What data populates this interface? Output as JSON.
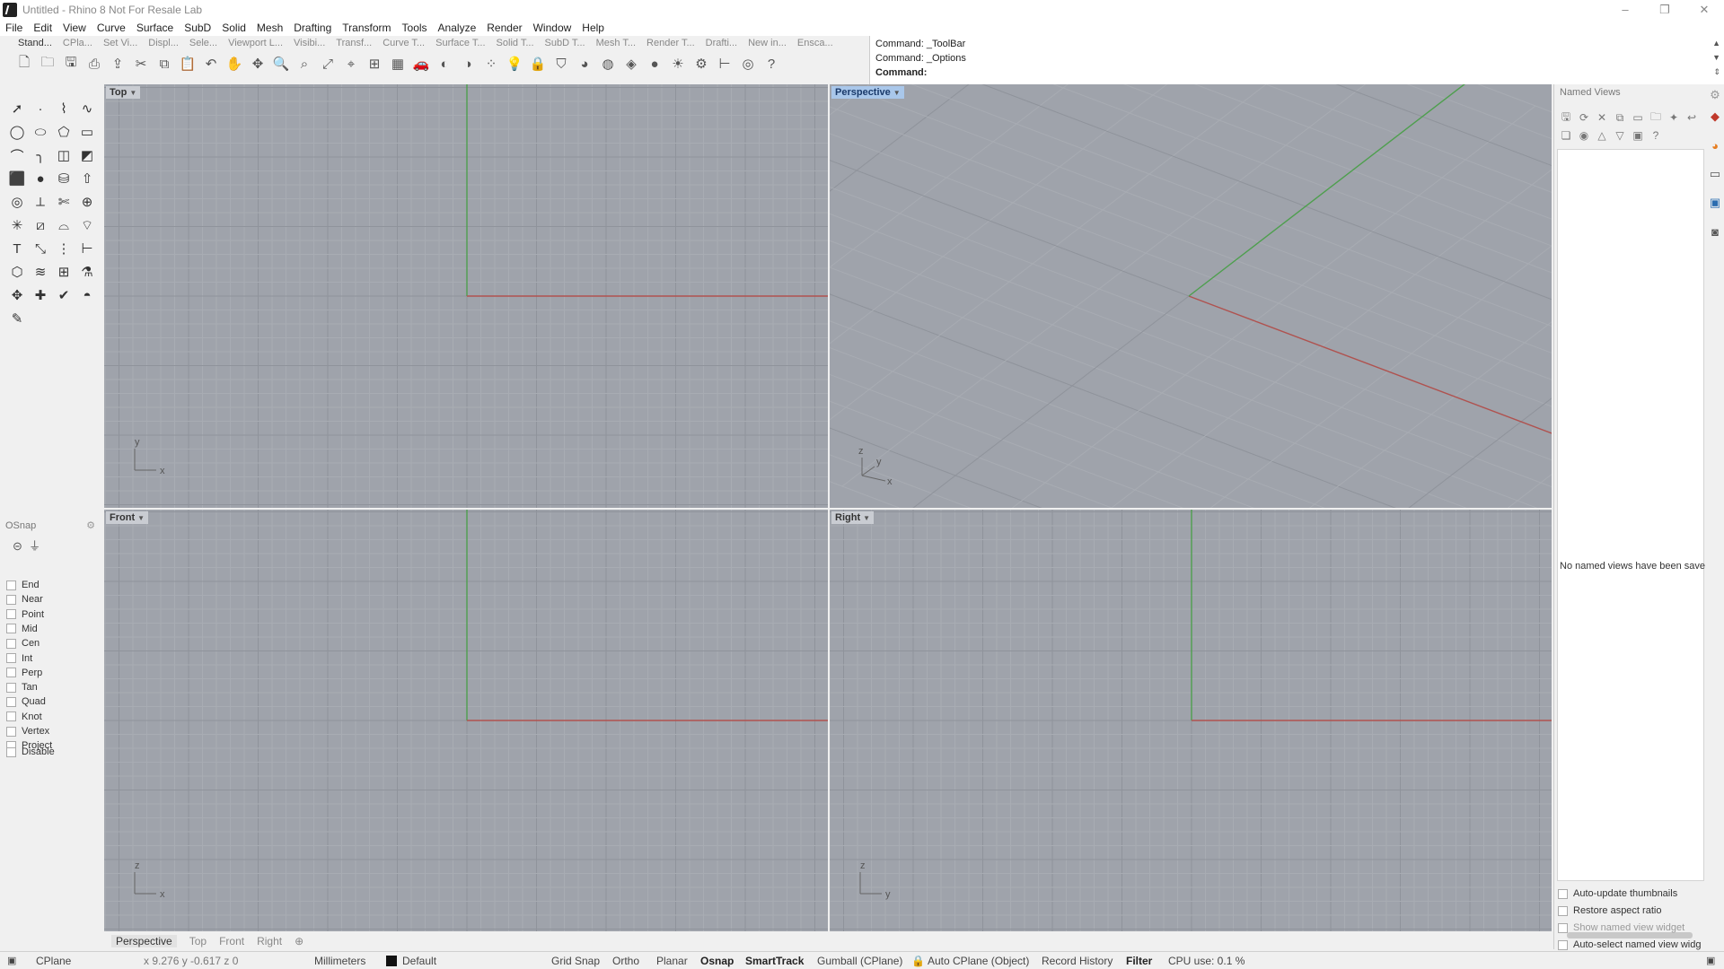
{
  "window": {
    "title": "Untitled - Rhino 8 Not For Resale Lab",
    "minimize_icon": "minimize-icon",
    "maximize_icon": "restore-icon",
    "close_icon": "close-icon"
  },
  "menu": [
    "File",
    "Edit",
    "View",
    "Curve",
    "Surface",
    "SubD",
    "Solid",
    "Mesh",
    "Drafting",
    "Transform",
    "Tools",
    "Analyze",
    "Render",
    "Window",
    "Help"
  ],
  "toolbar_tabs": [
    "Stand...",
    "CPla...",
    "Set Vi...",
    "Displ...",
    "Sele...",
    "Viewport L...",
    "Visibi...",
    "Transf...",
    "Curve T...",
    "Surface T...",
    "Solid T...",
    "SubD T...",
    "Mesh T...",
    "Render T...",
    "Drafti...",
    "New in...",
    "Ensca..."
  ],
  "toolbar_icons": [
    "new-file-icon",
    "open-icon",
    "save-icon",
    "print-icon",
    "import-icon",
    "cut-icon",
    "copy-icon",
    "paste-icon",
    "undo-icon",
    "pan-icon",
    "rotate-view-icon",
    "zoom-icon",
    "zoom-window-icon",
    "zoom-extents-icon",
    "zoom-selected-icon",
    "viewports-icon",
    "grid-icon",
    "car-icon",
    "hide-icon",
    "show-icon",
    "points-icon",
    "lightbulb-icon",
    "lock-icon",
    "shield-icon",
    "color-wheel-icon",
    "sphere-wire-icon",
    "material-icon",
    "render-sphere-icon",
    "light-icon",
    "gear-settings-icon",
    "dimension-icon",
    "globe-icon",
    "help-icon"
  ],
  "command": {
    "history": [
      "Command: _ToolBar",
      "Command: _Options"
    ],
    "prompt": "Command:"
  },
  "left_tools": [
    "select-arrow-icon",
    "point-icon",
    "polyline-icon",
    "curve-icon",
    "circle-icon",
    "ellipse-icon",
    "polygon-icon",
    "rectangle-icon",
    "arc-icon",
    "fillet-curve-icon",
    "surface-icon",
    "loft-icon",
    "box-icon",
    "sphere-icon",
    "cylinder-icon",
    "extrude-icon",
    "boolean-icon",
    "split-icon",
    "trim-icon",
    "join-icon",
    "explode-icon",
    "offset-icon",
    "fillet-icon",
    "chamfer-icon",
    "text-icon",
    "scale-icon",
    "array-icon",
    "dimension-icon",
    "mesh-icon",
    "flow-icon",
    "grid-array-icon",
    "pipe-icon",
    "gumball-icon",
    "move-icon",
    "check-icon",
    "sphere-render-icon",
    "pencil-icon"
  ],
  "osnap": {
    "title": "OSnap",
    "items": [
      "End",
      "Near",
      "Point",
      "Mid",
      "Cen",
      "Int",
      "Perp",
      "Tan",
      "Quad",
      "Knot",
      "Vertex",
      "Project"
    ],
    "disable": "Disable"
  },
  "viewports": {
    "top": "Top",
    "perspective": "Perspective",
    "front": "Front",
    "right": "Right",
    "axis_top": [
      "y",
      "x"
    ],
    "axis_persp": [
      "z",
      "y",
      "x"
    ],
    "axis_front": [
      "z",
      "x"
    ],
    "axis_right": [
      "z",
      "y"
    ]
  },
  "viewport_tabs": [
    "Perspective",
    "Top",
    "Front",
    "Right"
  ],
  "viewport_tab_add": "⊕",
  "named_views": {
    "title": "Named Views",
    "empty_message": "No named views have been save",
    "options": [
      "Auto-update thumbnails",
      "Restore aspect ratio",
      "Show named view widget",
      "Auto-select named view widg"
    ]
  },
  "status": {
    "cplane": "CPlane",
    "coords": "x 9.276  y -0.617  z 0",
    "units": "Millimeters",
    "layer": "Default",
    "grid_snap": "Grid Snap",
    "ortho": "Ortho",
    "planar": "Planar",
    "osnap": "Osnap",
    "smarttrack": "SmartTrack",
    "gumball": "Gumball (CPlane)",
    "auto_cplane": "Auto CPlane (Object)",
    "record_history": "Record History",
    "filter": "Filter",
    "cpu": "CPU use: 0.1 %"
  },
  "colors": {
    "viewport_bg": "#9fa3ab",
    "grid_minor": "#a8acb3",
    "grid_major": "#8f939b",
    "x_axis": "#b0524f",
    "y_axis": "#4e9f4e",
    "active_label": "#a9c7ea"
  }
}
